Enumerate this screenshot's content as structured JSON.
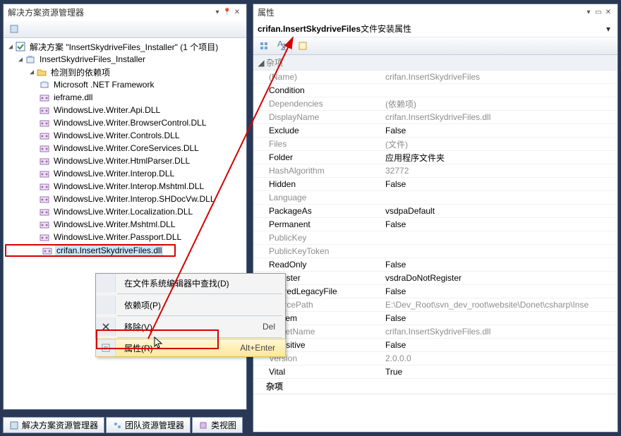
{
  "explorer": {
    "title": "解决方案资源管理器",
    "root_label": "解决方案 \"InsertSkydriveFiles_Installer\" (1 个项目)",
    "project_label": "InsertSkydriveFiles_Installer",
    "deps_label": "检测到的依赖项",
    "items": [
      "Microsoft .NET Framework",
      "ieframe.dll",
      "WindowsLive.Writer.Api.DLL",
      "WindowsLive.Writer.BrowserControl.DLL",
      "WindowsLive.Writer.Controls.DLL",
      "WindowsLive.Writer.CoreServices.DLL",
      "WindowsLive.Writer.HtmlParser.DLL",
      "WindowsLive.Writer.Interop.DLL",
      "WindowsLive.Writer.Interop.Mshtml.DLL",
      "WindowsLive.Writer.Interop.SHDocVw.DLL",
      "WindowsLive.Writer.Localization.DLL",
      "WindowsLive.Writer.Mshtml.DLL",
      "WindowsLive.Writer.Passport.DLL"
    ],
    "selected_item": "crifan.InsertSkydriveFiles.dll"
  },
  "context_menu": {
    "find": "在文件系统编辑器中查找(D)",
    "deps": "依赖项(P)",
    "remove": "移除(V)",
    "remove_sc": "Del",
    "props": "属性(R)",
    "props_sc": "Alt+Enter"
  },
  "properties": {
    "title": "属性",
    "header_bold": "crifan.InsertSkydriveFiles",
    "header_rest": " 文件安装属性",
    "cat": "杂项",
    "cat2": "杂项",
    "rows": [
      {
        "k": "(Name)",
        "v": "crifan.InsertSkydriveFiles",
        "dim": true
      },
      {
        "k": "Condition",
        "v": ""
      },
      {
        "k": "Dependencies",
        "v": "(依赖项)",
        "dim": true
      },
      {
        "k": "DisplayName",
        "v": "crifan.InsertSkydriveFiles.dll",
        "dim": true
      },
      {
        "k": "Exclude",
        "v": "False"
      },
      {
        "k": "Files",
        "v": "(文件)",
        "dim": true
      },
      {
        "k": "Folder",
        "v": "应用程序文件夹"
      },
      {
        "k": "HashAlgorithm",
        "v": "32772",
        "dim": true
      },
      {
        "k": "Hidden",
        "v": "False"
      },
      {
        "k": "Language",
        "v": "",
        "dim": true
      },
      {
        "k": "PackageAs",
        "v": "vsdpaDefault"
      },
      {
        "k": "Permanent",
        "v": "False"
      },
      {
        "k": "PublicKey",
        "v": "",
        "dim": true
      },
      {
        "k": "PublicKeyToken",
        "v": "",
        "dim": true
      },
      {
        "k": "ReadOnly",
        "v": "False"
      },
      {
        "k": "Register",
        "v": "vsdraDoNotRegister"
      },
      {
        "k": "SharedLegacyFile",
        "v": "False"
      },
      {
        "k": "SourcePath",
        "v": "E:\\Dev_Root\\svn_dev_root\\website\\Donet\\csharp\\Inse",
        "dim": true
      },
      {
        "k": "System",
        "v": "False"
      },
      {
        "k": "TargetName",
        "v": "crifan.InsertSkydriveFiles.dll",
        "dim": true
      },
      {
        "k": "Transitive",
        "v": "False"
      },
      {
        "k": "Version",
        "v": "2.0.0.0",
        "dim": true
      },
      {
        "k": "Vital",
        "v": "True"
      }
    ]
  },
  "bottom_tabs": {
    "t1": "解决方案资源管理器",
    "t2": "团队资源管理器",
    "t3": "类视图"
  }
}
